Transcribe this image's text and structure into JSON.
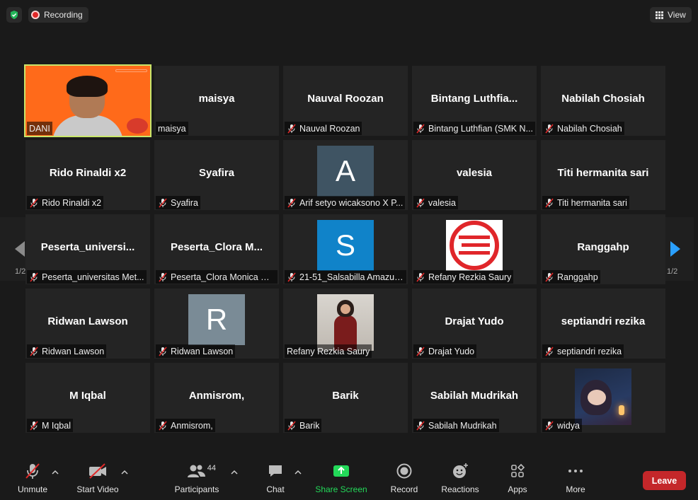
{
  "top": {
    "recording_label": "Recording",
    "view_label": "View"
  },
  "pagination": {
    "left": "1/2",
    "right": "1/2"
  },
  "tiles": [
    {
      "center": "",
      "plate": "DANI",
      "muted": false,
      "kind": "video"
    },
    {
      "center": "maisya",
      "plate": "maisya",
      "muted": false,
      "kind": "name"
    },
    {
      "center": "Nauval Roozan",
      "plate": "Nauval Roozan",
      "muted": true,
      "kind": "name"
    },
    {
      "center": "Bintang  Luthfia...",
      "plate": "Bintang Luthfian (SMK N...",
      "muted": true,
      "kind": "name"
    },
    {
      "center": "Nabilah Chosiah",
      "plate": "Nabilah Chosiah",
      "muted": true,
      "kind": "name"
    },
    {
      "center": "Rido Rinaldi x2",
      "plate": "Rido Rinaldi x2",
      "muted": true,
      "kind": "name"
    },
    {
      "center": "Syafira",
      "plate": "Syafira",
      "muted": true,
      "kind": "name"
    },
    {
      "center": "A",
      "plate": "Arif setyo wicaksono X P...",
      "muted": true,
      "kind": "avatar",
      "color": "#3f5463"
    },
    {
      "center": "valesia",
      "plate": "valesia",
      "muted": true,
      "kind": "name"
    },
    {
      "center": "Titi hermanita sari",
      "plate": "Titi hermanita sari",
      "muted": true,
      "kind": "name"
    },
    {
      "center": "Peserta_universi...",
      "plate": "Peserta_universitas Met...",
      "muted": true,
      "kind": "name"
    },
    {
      "center": "Peserta_Clora  M...",
      "plate": "Peserta_Clora Monica W...",
      "muted": true,
      "kind": "name"
    },
    {
      "center": "S",
      "plate": "21-51_Salsabilla Amazuli...",
      "muted": true,
      "kind": "avatar",
      "color": "#1083c9"
    },
    {
      "center": "",
      "plate": "Refany Rezkia Saury",
      "muted": true,
      "kind": "logo"
    },
    {
      "center": "Ranggahp",
      "plate": "Ranggahp",
      "muted": true,
      "kind": "name"
    },
    {
      "center": "Ridwan Lawson",
      "plate": "Ridwan Lawson",
      "muted": true,
      "kind": "name"
    },
    {
      "center": "R",
      "plate": "Ridwan Lawson",
      "muted": true,
      "kind": "avatar",
      "color": "#7a8b96"
    },
    {
      "center": "",
      "plate": "Refany Rezkia Saury",
      "muted": false,
      "kind": "photo"
    },
    {
      "center": "Drajat Yudo",
      "plate": "Drajat Yudo",
      "muted": true,
      "kind": "name"
    },
    {
      "center": "septiandri rezika",
      "plate": "septiandri rezika",
      "muted": true,
      "kind": "name"
    },
    {
      "center": "M Iqbal",
      "plate": "M Iqbal",
      "muted": true,
      "kind": "name"
    },
    {
      "center": "Anmisrom,",
      "plate": "Anmisrom,",
      "muted": true,
      "kind": "name"
    },
    {
      "center": "Barik",
      "plate": "Barik",
      "muted": true,
      "kind": "name"
    },
    {
      "center": "Sabilah Mudrikah",
      "plate": "Sabilah Mudrikah",
      "muted": true,
      "kind": "name"
    },
    {
      "center": "",
      "plate": "widya",
      "muted": true,
      "kind": "art"
    }
  ],
  "toolbar": {
    "unmute": "Unmute",
    "start_video": "Start Video",
    "participants": "Participants",
    "participants_count": "44",
    "chat": "Chat",
    "share_screen": "Share Screen",
    "record": "Record",
    "reactions": "Reactions",
    "apps": "Apps",
    "more": "More",
    "leave": "Leave"
  },
  "colors": {
    "active_speaker_border": "#c8e66a",
    "share_green": "#23d959",
    "leave_red": "#c4272a",
    "muted_red": "#e02828"
  }
}
